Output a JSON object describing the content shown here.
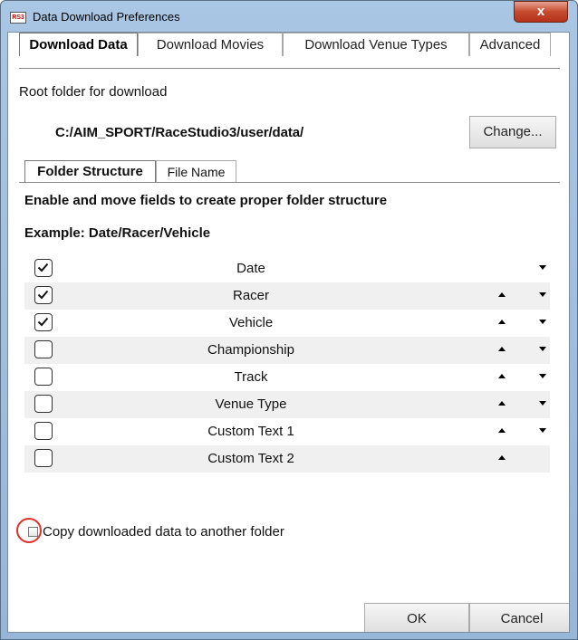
{
  "window": {
    "title": "Data Download Preferences",
    "close_glyph": "x"
  },
  "tabs": [
    {
      "label": "Download Data",
      "active": true
    },
    {
      "label": "Download Movies",
      "active": false
    },
    {
      "label": "Download Venue Types",
      "active": false
    },
    {
      "label": "Advanced",
      "active": false
    }
  ],
  "root": {
    "label": "Root folder for download",
    "path": "C:/AIM_SPORT/RaceStudio3/user/data/",
    "change_label": "Change..."
  },
  "subtabs": [
    {
      "label": "Folder Structure",
      "active": true
    },
    {
      "label": "File Name",
      "active": false
    }
  ],
  "instructions": "Enable and move fields to create proper folder structure",
  "example": "Example: Date/Racer/Vehicle",
  "fields": [
    {
      "label": "Date",
      "checked": true,
      "up": false,
      "down": true
    },
    {
      "label": "Racer",
      "checked": true,
      "up": true,
      "down": true
    },
    {
      "label": "Vehicle",
      "checked": true,
      "up": true,
      "down": true
    },
    {
      "label": "Championship",
      "checked": false,
      "up": true,
      "down": true
    },
    {
      "label": "Track",
      "checked": false,
      "up": true,
      "down": true
    },
    {
      "label": "Venue Type",
      "checked": false,
      "up": true,
      "down": true
    },
    {
      "label": "Custom Text 1",
      "checked": false,
      "up": true,
      "down": true
    },
    {
      "label": "Custom Text 2",
      "checked": false,
      "up": true,
      "down": false
    }
  ],
  "copy_option": {
    "label": "Copy downloaded data to another folder",
    "checked": false
  },
  "buttons": {
    "ok": "OK",
    "cancel": "Cancel"
  },
  "colors": {
    "highlight_circle": "#e0302a",
    "title_bar": "#a9c6e4",
    "close_button": "#c64a2e"
  }
}
